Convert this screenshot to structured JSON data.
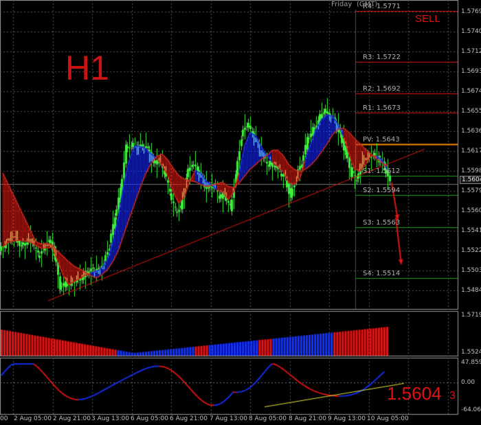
{
  "timeframe_label": "H1",
  "signal_label": "SELL",
  "header": {
    "day": "Friday",
    "timezone": "(GMT)"
  },
  "big_price": {
    "main": "1.5604",
    "suffix": "3"
  },
  "current_price_tag": "1.56043",
  "price_axis": [
    "1.57690",
    "1.57405",
    "1.57120",
    "1.56935",
    "1.56745",
    "1.56555",
    "1.56365",
    "1.56175",
    "1.55980",
    "1.55790",
    "1.55600",
    "1.55410",
    "1.55220",
    "1.55030",
    "1.54840"
  ],
  "pivot_levels": [
    {
      "label": "R4: 1.5771",
      "value": 1.5771,
      "color": "#e01010"
    },
    {
      "label": "R3: 1.5722",
      "value": 1.5722,
      "color": "#e01010"
    },
    {
      "label": "R2: 1.5692",
      "value": 1.5692,
      "color": "#e01010"
    },
    {
      "label": "R1: 1.5673",
      "value": 1.5673,
      "color": "#e01010"
    },
    {
      "label": "PV: 1.5643",
      "value": 1.5643,
      "color": "#ff8c00"
    },
    {
      "label": "S1: 1.5612",
      "value": 1.5612,
      "color": "#1aa01a"
    },
    {
      "label": "S2: 1.5594",
      "value": 1.5594,
      "color": "#1aa01a"
    },
    {
      "label": "S3: 1.5563",
      "value": 1.5563,
      "color": "#1aa01a"
    },
    {
      "label": "S4: 1.5514",
      "value": 1.5514,
      "color": "#1aa01a"
    }
  ],
  "histogram_axis": [
    "1.5719",
    "1.5524"
  ],
  "oscillator_axis": [
    "47.8591",
    "0.00",
    "-64.0623"
  ],
  "time_axis": [
    "00",
    "2 Aug 05:00",
    "2 Aug 21:00",
    "3 Aug 13:00",
    "6 Aug 05:00",
    "6 Aug 21:00",
    "7 Aug 13:00",
    "8 Aug 05:00",
    "8 Aug 21:00",
    "9 Aug 13:00",
    "10 Aug 05:00"
  ],
  "colors": {
    "bull_candle": "#3cf03c",
    "ribbon_bear": "#c8281e",
    "ribbon_bull": "#1e32dc",
    "histogram_bear": "#e61414",
    "histogram_bull": "#1432ff",
    "trendline": "#e01414",
    "osc_trendline": "#e6e632"
  },
  "chart_data": {
    "type": "candlestick",
    "title": "H1",
    "price_range": [
      1.5484,
      1.5779
    ],
    "close": [
      1.5544,
      1.5552,
      1.5553,
      1.5545,
      1.5551,
      1.5549,
      1.5536,
      1.5542,
      1.555,
      1.5538,
      1.5503,
      1.5508,
      1.551,
      1.5514,
      1.5515,
      1.552,
      1.5521,
      1.552,
      1.5528,
      1.5545,
      1.5572,
      1.5598,
      1.5641,
      1.5643,
      1.5639,
      1.564,
      1.5636,
      1.5624,
      1.5627,
      1.5616,
      1.5596,
      1.5579,
      1.5583,
      1.5613,
      1.5623,
      1.5616,
      1.5606,
      1.56,
      1.5604,
      1.5592,
      1.5595,
      1.5581,
      1.5614,
      1.565,
      1.5661,
      1.5651,
      1.5641,
      1.563,
      1.5624,
      1.5623,
      1.5617,
      1.5609,
      1.5592,
      1.5611,
      1.5624,
      1.5647,
      1.5657,
      1.5667,
      1.5676,
      1.567,
      1.5664,
      1.5651,
      1.5634,
      1.5614,
      1.5608,
      1.5629,
      1.5632,
      1.5634,
      1.5628,
      1.5621,
      1.5604
    ]
  }
}
